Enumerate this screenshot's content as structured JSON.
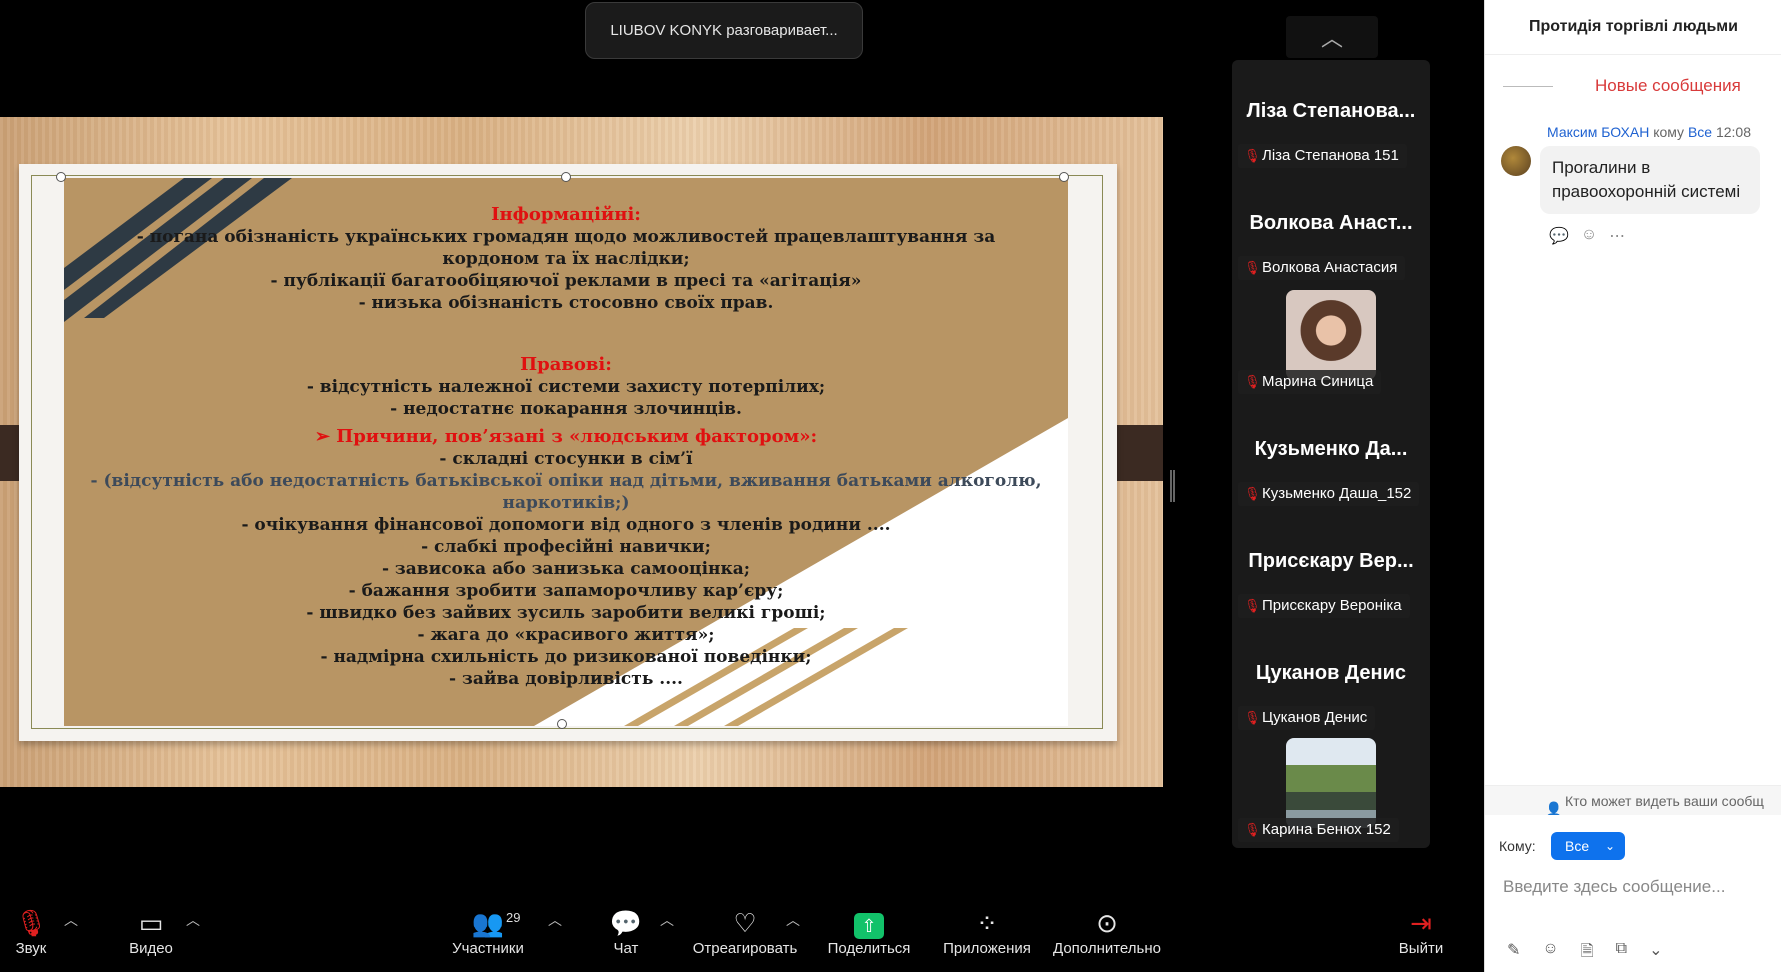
{
  "speaker_banner": "LIUBOV KONYK разговаривает...",
  "slide": {
    "heading_info": "Інформаційні:",
    "info_lines": [
      "- погана обізнаність українських громадян щодо можливостей   працевлаштування  за",
      "кордоном та їх наслідки;",
      "- публікації багатообіцяючої реклами в пресі та «агітація»",
      "-     низька обізнаність стосовно своїх прав."
    ],
    "heading_legal": "Правові:",
    "legal_lines": [
      "- відсутність належної системи захисту потерпілих;",
      "- недостатнє покарання злочинців."
    ],
    "heading_human": "➢     Причини, пов’язані з «людським фактором»:",
    "human_lines": [
      "-     складні стосунки в сім’ї",
      "-      (відсутність або недостатність батьківської опіки над дітьми, вживання батьками алкоголю,",
      "наркотиків;)",
      "-     очікування фінансової допомоги від одного з членів родини ....",
      "- слабкі професійні навички;",
      "- зависока або занизька самооцінка;",
      "- бажання зробити запаморочливу кар’єру;",
      "- швидко без зайвих зусиль заробити великі гроші;",
      "- жага до «красивого життя»;",
      "- надмірна схильність до ризикованої поведінки;",
      "- зайва довірливість ...."
    ]
  },
  "gallery": {
    "tiles": [
      {
        "name": "Ліза Степанова...",
        "label": "Ліза Степанова 151",
        "has_video": false
      },
      {
        "name": "Волкова Анаст...",
        "label": "Волкова Анастасия",
        "has_video": false
      },
      {
        "name": "",
        "label": "Марина Синица",
        "has_video": true
      },
      {
        "name": "Кузьменко Да...",
        "label": "Кузьменко Даша_152",
        "has_video": false
      },
      {
        "name": "Присєкару Вер...",
        "label": "Присєкару Вероніка",
        "has_video": false
      },
      {
        "name": "Цуканов Денис",
        "label": "Цуканов Денис",
        "has_video": false
      },
      {
        "name": "",
        "label": "Карина Бенюх 152",
        "has_video": true
      }
    ]
  },
  "chat": {
    "title": "Протидія торгівлі людьми",
    "new_messages": "Новые сообщения",
    "message": {
      "sender": "Максим БОХАН",
      "to_word": "кому",
      "recipient": "Все",
      "time": "12:08",
      "text": "Проrалини в правоохоронній системі"
    },
    "who_can_see": "Кто может видеть ваши сообщ",
    "to_label": "Кому:",
    "to_value": "Все",
    "input_placeholder": "Введите здесь сообщение..."
  },
  "toolbar": {
    "audio": "Звук",
    "video": "Видео",
    "participants": "Участники",
    "participants_count": "29",
    "chat": "Чат",
    "react": "Отреагировать",
    "share": "Поделиться",
    "apps": "Приложения",
    "more": "Дополнительно",
    "leave": "Выйти"
  },
  "colors": {
    "accent_blue": "#0e72ed",
    "share_green": "#12c26a",
    "new_msg_red": "#d83a3a",
    "slide_gold": "#b89564"
  }
}
